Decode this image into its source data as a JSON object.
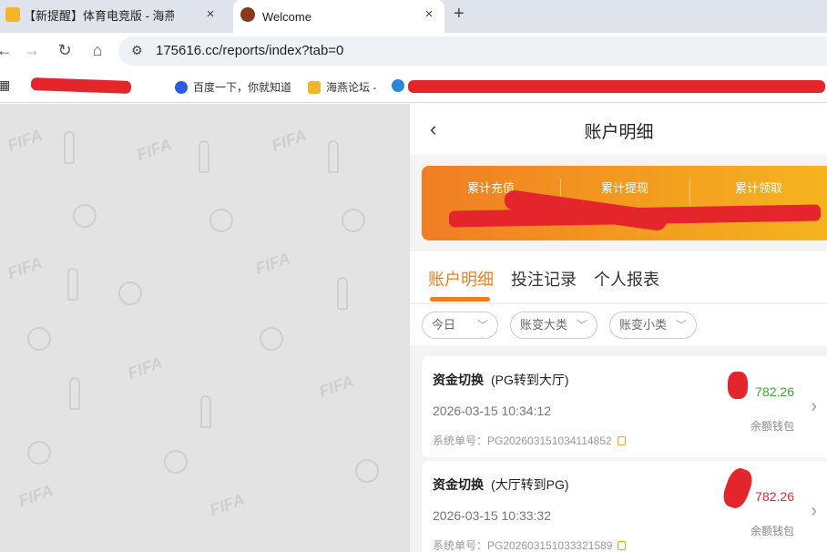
{
  "browser": {
    "tabs": [
      {
        "title": "【新提醒】体育电竞版 - 海燕筹",
        "close": "×"
      },
      {
        "title": "Welcome",
        "close": "×"
      }
    ],
    "new_tab": "+",
    "url": "175616.cc/reports/index?tab=0",
    "bookmarks": [
      {
        "label": "百度一下，你就知道"
      },
      {
        "label": "海燕论坛 -"
      }
    ]
  },
  "app": {
    "title": "账户明细",
    "summary": [
      {
        "label": "累计充值"
      },
      {
        "label": "累计提现"
      },
      {
        "label": "累计领取"
      }
    ],
    "tabs": [
      {
        "label": "账户明细",
        "active": true
      },
      {
        "label": "投注记录",
        "active": false
      },
      {
        "label": "个人报表",
        "active": false
      }
    ],
    "filters": [
      {
        "label": "今日"
      },
      {
        "label": "账变大类"
      },
      {
        "label": "账变小类"
      }
    ],
    "records": [
      {
        "type": "资金切换",
        "detail": "(PG转到大厅)",
        "time": "2026-03-15 10:34:12",
        "order": "系统单号：PG202603151034114852",
        "amount": "782.26",
        "amount_color": "#3aaa35",
        "wallet": "余额钱包"
      },
      {
        "type": "资金切换",
        "detail": "(大厅转到PG)",
        "time": "2026-03-15 10:33:32",
        "order": "系统单号：PG202603151033321589",
        "amount": "782.26",
        "amount_color": "#e4252b",
        "wallet": "余额钱包"
      }
    ]
  },
  "colors": {
    "accent": "#f07d24",
    "redaction": "#e4252b"
  }
}
